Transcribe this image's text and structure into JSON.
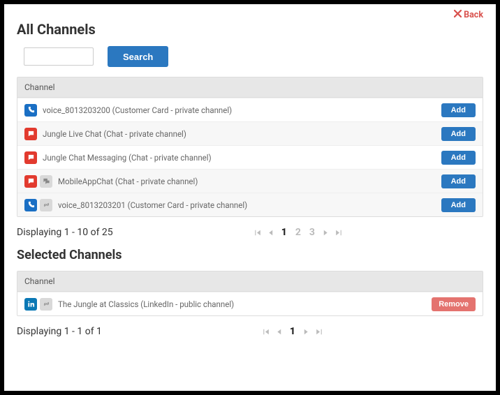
{
  "back_label": "Back",
  "titles": {
    "all": "All Channels",
    "selected": "Selected Channels"
  },
  "search": {
    "placeholder": "",
    "button": "Search"
  },
  "table_header": "Channel",
  "buttons": {
    "add": "Add",
    "remove": "Remove"
  },
  "all_channels": {
    "rows": [
      {
        "label": "voice_8013203200 (Customer Card - private channel)"
      },
      {
        "label": "Jungle Live Chat (Chat - private channel)"
      },
      {
        "label": "Jungle Chat Messaging (Chat - private channel)"
      },
      {
        "label": "MobileAppChat (Chat - private channel)"
      },
      {
        "label": "voice_8013203201 (Customer Card - private channel)"
      }
    ],
    "status": "Displaying 1 - 10 of 25",
    "pages": [
      "1",
      "2",
      "3"
    ],
    "active_page": "1"
  },
  "selected_channels": {
    "rows": [
      {
        "label": "The Jungle at Classics (LinkedIn - public channel)"
      }
    ],
    "status": "Displaying 1 - 1 of 1",
    "pages": [
      "1"
    ],
    "active_page": "1"
  }
}
